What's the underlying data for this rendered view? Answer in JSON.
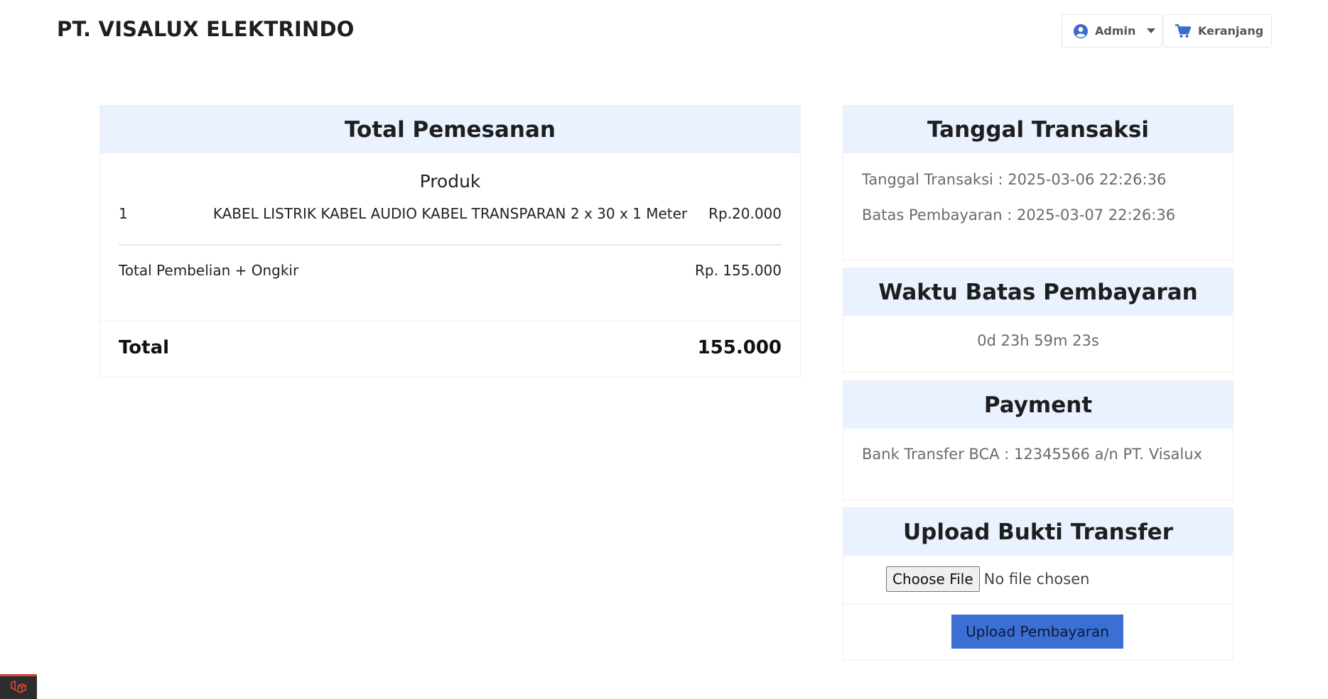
{
  "header": {
    "brand": "PT. VISALUX ELEKTRINDO",
    "user_label": "Admin",
    "cart_label": "Keranjang"
  },
  "order": {
    "title": "Total Pemesanan",
    "product_heading": "Produk",
    "items": [
      {
        "no": "1",
        "name": "KABEL LISTRIK KABEL AUDIO KABEL TRANSPARAN 2 x 30 x 1 Meter",
        "price": "Rp.20.000"
      }
    ],
    "subtotal_label": "Total Pembelian + Ongkir",
    "subtotal_value": "Rp. 155.000",
    "total_label": "Total",
    "total_value": "155.000"
  },
  "transaction": {
    "title": "Tanggal Transaksi",
    "date_line": "Tanggal Transaksi : 2025-03-06 22:26:36",
    "deadline_line": "Batas Pembayaran : 2025-03-07 22:26:36"
  },
  "deadline_timer": {
    "title": "Waktu Batas Pembayaran",
    "countdown": "0d 23h 59m 23s"
  },
  "payment": {
    "title": "Payment",
    "method": "Bank Transfer BCA : 12345566 a/n PT. Visalux"
  },
  "upload": {
    "title": "Upload Bukti Transfer",
    "choose_file_label": "Choose File",
    "file_status": "No file chosen",
    "submit_label": "Upload Pembayaran"
  },
  "colors": {
    "accent": "#3b6fd4",
    "card_header_bg": "#eaf1ff",
    "icon_blue": "#3a6bc9"
  },
  "icons": {
    "user": "user-circle-icon",
    "cart": "shopping-cart-icon",
    "caret": "caret-down-icon",
    "debug": "laravel-logo-icon"
  }
}
